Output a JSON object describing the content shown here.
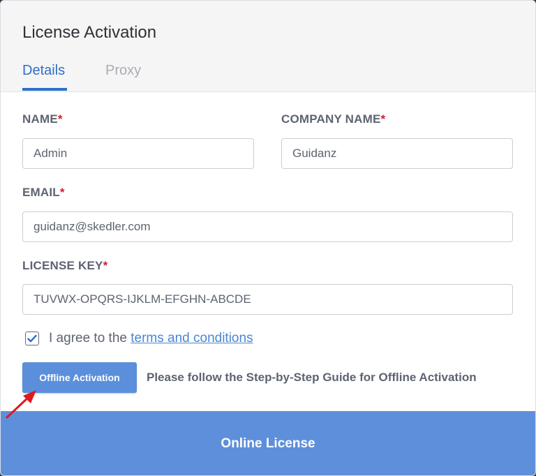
{
  "dialog": {
    "title": "License Activation",
    "tabs": [
      {
        "label": "Details",
        "active": true
      },
      {
        "label": "Proxy",
        "active": false
      }
    ]
  },
  "form": {
    "name": {
      "label": "NAME",
      "required_mark": "*",
      "value": "Admin"
    },
    "company": {
      "label": "COMPANY NAME",
      "required_mark": "*",
      "value": "Guidanz"
    },
    "email": {
      "label": "EMAIL",
      "required_mark": "*",
      "value": "guidanz@skedler.com"
    },
    "license_key": {
      "label": "LICENSE KEY",
      "required_mark": "*",
      "value": "TUVWX-OPQRS-IJKLM-EFGHN-ABCDE"
    },
    "agree": {
      "checked": true,
      "prefix": "I agree to the",
      "link_text": "terms and conditions"
    }
  },
  "offline": {
    "button_label": "Offline Activation",
    "guide_text": "Please follow the Step-by-Step Guide for Offline Activation"
  },
  "footer": {
    "online_button_label": "Online License"
  },
  "colors": {
    "accent": "#2f6fc9",
    "button_bg": "#5e8fdb",
    "required": "#d0202b",
    "annotation_arrow": "#e0181f"
  },
  "icons": {
    "checkbox": "check-icon",
    "annotation": "red-arrow-icon"
  }
}
